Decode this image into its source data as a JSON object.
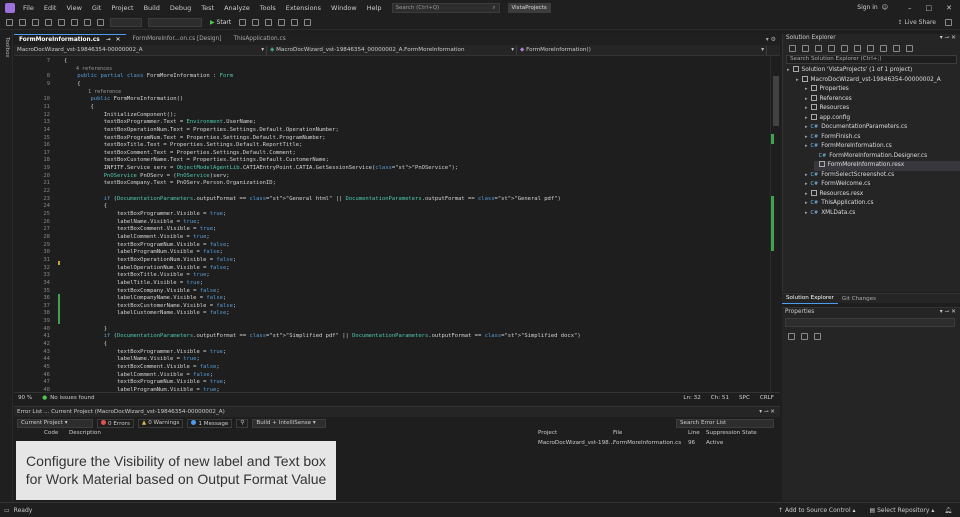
{
  "titlebar": {
    "menu": [
      "File",
      "Edit",
      "View",
      "Git",
      "Project",
      "Build",
      "Debug",
      "Test",
      "Analyze",
      "Tools",
      "Extensions",
      "Window",
      "Help"
    ],
    "search_placeholder": "Search (Ctrl+Q)",
    "project_badge": "VistaProjects",
    "sign_in": "Sign in"
  },
  "toolbar": {
    "start_label": "Start",
    "live_share": "Live Share"
  },
  "left_strip": {
    "label": "Toolbox"
  },
  "doc_tabs": [
    {
      "label": "FormMoreInformation.cs",
      "active": true
    },
    {
      "label": "FormMoreInfor...on.cs [Design]",
      "active": false
    },
    {
      "label": "ThisApplication.cs",
      "active": false
    }
  ],
  "navbar": {
    "project": "MacroDocWizard_vst-19846354-00000002_A",
    "class": "MacroDocWizard_vst-19846354_00000002_A.FormMoreInformation",
    "member": "FormMoreInformation()"
  },
  "editor": {
    "lines": [
      {
        "n": "7",
        "code": "{"
      },
      {
        "n": "",
        "code": "    4 references"
      },
      {
        "n": "8",
        "code": "    public partial class FormMoreInformation : Form"
      },
      {
        "n": "9",
        "code": "    {"
      },
      {
        "n": "",
        "code": "        1 reference"
      },
      {
        "n": "10",
        "code": "        public FormMoreInformation()"
      },
      {
        "n": "11",
        "code": "        {"
      },
      {
        "n": "12",
        "code": "            InitializeComponent();"
      },
      {
        "n": "13",
        "code": "            textBoxProgrammer.Text = Environment.UserName;"
      },
      {
        "n": "14",
        "code": "            textBoxOperationNum.Text = Properties.Settings.Default.OperationNumber;"
      },
      {
        "n": "15",
        "code": "            textBoxProgramNum.Text = Properties.Settings.Default.ProgramNumber;"
      },
      {
        "n": "16",
        "code": "            textBoxTitle.Text = Properties.Settings.Default.ReportTitle;"
      },
      {
        "n": "17",
        "code": "            textBoxComment.Text = Properties.Settings.Default.Comment;"
      },
      {
        "n": "18",
        "code": "            textBoxCustomerName.Text = Properties.Settings.Default.CustomerName;"
      },
      {
        "n": "19",
        "code": "            INFITF.Service serv = ObjectModelAgentLib.CATIAEntryPoint.CATIA.GetSessionService(\"PnOService\");"
      },
      {
        "n": "20",
        "code": "            PnOService PnOServ = (PnOService)serv;"
      },
      {
        "n": "21",
        "code": "            textBoxCompany.Text = PnOServ.Person.OrganizationID;"
      },
      {
        "n": "22",
        "code": ""
      },
      {
        "n": "23",
        "code": "            if (DocumentationParameters.outputFormat == \"General html\" || DocumentationParameters.outputFormat == \"General pdf\")"
      },
      {
        "n": "24",
        "code": "            {"
      },
      {
        "n": "25",
        "code": "                textBoxProgrammer.Visible = true;"
      },
      {
        "n": "26",
        "code": "                labelName.Visible = true;"
      },
      {
        "n": "27",
        "code": "                textBoxComment.Visible = true;"
      },
      {
        "n": "28",
        "code": "                labelComment.Visible = true;"
      },
      {
        "n": "29",
        "code": "                textBoxProgramNum.Visible = false;"
      },
      {
        "n": "30",
        "code": "                labelProgramNum.Visible = false;"
      },
      {
        "n": "31",
        "code": "                textBoxOperationNum.Visible = false;"
      },
      {
        "n": "32",
        "code": "                labelOperationNum.Visible = false;"
      },
      {
        "n": "33",
        "code": "                textBoxTitle.Visible = true;"
      },
      {
        "n": "34",
        "code": "                labelTitle.Visible = true;"
      },
      {
        "n": "35",
        "code": "                textBoxCompany.Visible = false;"
      },
      {
        "n": "36",
        "code": "                labelCompanyName.Visible = false;"
      },
      {
        "n": "37",
        "code": "                textBoxCustomerName.Visible = false;"
      },
      {
        "n": "38",
        "code": "                labelCustomerName.Visible = false;"
      },
      {
        "n": "39",
        "code": ""
      },
      {
        "n": "40",
        "code": "            }"
      },
      {
        "n": "41",
        "code": "            if (DocumentationParameters.outputFormat == \"Simplified pdf\" || DocumentationParameters.outputFormat == \"Simplified docx\")"
      },
      {
        "n": "42",
        "code": "            {"
      },
      {
        "n": "43",
        "code": "                textBoxProgrammer.Visible = true;"
      },
      {
        "n": "44",
        "code": "                labelName.Visible = true;"
      },
      {
        "n": "45",
        "code": "                textBoxComment.Visible = false;"
      },
      {
        "n": "46",
        "code": "                labelComment.Visible = false;"
      },
      {
        "n": "47",
        "code": "                textBoxProgramNum.Visible = true;"
      },
      {
        "n": "48",
        "code": "                labelProgramNum.Visible = true;"
      }
    ]
  },
  "editor_status": {
    "zoom": "90 %",
    "issues": "No issues found",
    "ln": "Ln: 32",
    "ch": "Ch: 51",
    "spc": "SPC",
    "crlf": "CRLF"
  },
  "error_list": {
    "title": "Error List ... Current Project (MacroDocWizard_vst-19846354-00000002_A)",
    "scope": "Current Project",
    "errors": "0 Errors",
    "warnings": "0 Warnings",
    "messages": "1 Message",
    "build_filter": "Build + IntelliSense",
    "search_placeholder": "Search Error List",
    "columns": {
      "code": "Code",
      "description": "Description",
      "project": "Project",
      "file": "File",
      "line": "Line",
      "suppression": "Suppression State"
    },
    "rows": [
      {
        "project": "MacroDocWizard_vst-198...",
        "file": "FormMoreInformation.cs",
        "line": "96",
        "suppression": "Active"
      }
    ]
  },
  "caption": {
    "line1": "Configure the Visibility of new label and Text box",
    "line2": "for Work Material based on Output Format Value"
  },
  "solution_explorer": {
    "title": "Solution Explorer",
    "search_placeholder": "Search Solution Explorer (Ctrl+;)",
    "items": [
      {
        "label": "Solution 'VistaProjects' (1 of 1 project)",
        "depth": 0
      },
      {
        "label": "MacroDocWizard_vst-19846354-00000002_A",
        "depth": 1
      },
      {
        "label": "Properties",
        "depth": 2
      },
      {
        "label": "References",
        "depth": 2
      },
      {
        "label": "Resources",
        "depth": 2
      },
      {
        "label": "app.config",
        "depth": 2
      },
      {
        "label": "DocumentationParameters.cs",
        "depth": 2
      },
      {
        "label": "FormFinish.cs",
        "depth": 2
      },
      {
        "label": "FormMoreInformation.cs",
        "depth": 2
      },
      {
        "label": "FormMoreInformation.Designer.cs",
        "depth": 3
      },
      {
        "label": "FormMoreInformation.resx",
        "depth": 3,
        "selected": true
      },
      {
        "label": "FormSelectScreenshot.cs",
        "depth": 2
      },
      {
        "label": "FormWelcome.cs",
        "depth": 2
      },
      {
        "label": "Resources.resx",
        "depth": 2
      },
      {
        "label": "ThisApplication.cs",
        "depth": 2
      },
      {
        "label": "XMLData.cs",
        "depth": 2
      }
    ]
  },
  "se_tabs": [
    "Solution Explorer",
    "Git Changes"
  ],
  "properties": {
    "title": "Properties"
  },
  "statusbar": {
    "ready": "Ready",
    "source_control": "Add to Source Control",
    "repository": "Select Repository"
  },
  "colors": {
    "accent": "#4d9cf1",
    "bg": "#1e1e1e",
    "keyword": "#569cd6",
    "type": "#4ec9b0",
    "string": "#d69d85"
  }
}
